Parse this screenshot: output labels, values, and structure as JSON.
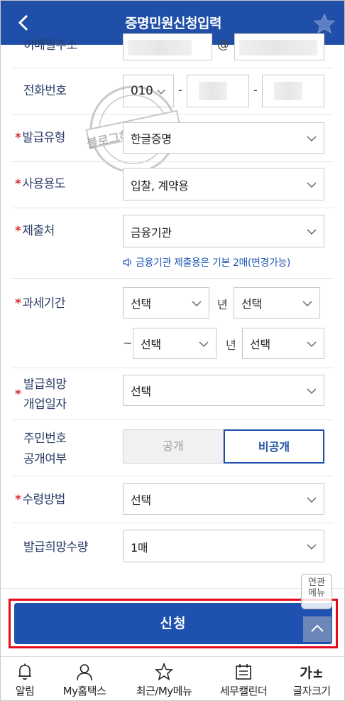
{
  "header": {
    "title": "증명민원신청입력"
  },
  "form": {
    "email": {
      "label": "이메일주소",
      "at": "@"
    },
    "phone": {
      "label": "전화번호",
      "prefix": "010",
      "dash": "-"
    },
    "issue_type": {
      "label": "발급유형",
      "value": "한글증명"
    },
    "usage": {
      "label": "사용용도",
      "value": "입찰, 계약용"
    },
    "submit_to": {
      "label": "제출처",
      "value": "금융기관",
      "notice": "금융기관 제출용은 기본 2매(변경가능)"
    },
    "tax_period": {
      "label": "과세기간",
      "start_year": "선택",
      "start_month": "선택",
      "end_year": "선택",
      "end_month": "선택",
      "year_unit": "년",
      "tilde": "~"
    },
    "open_date": {
      "label_line1": "발급희망",
      "label_line2": "개업일자",
      "value": "선택"
    },
    "rrn_disclosure": {
      "label_line1": "주민번호",
      "label_line2": "공개여부",
      "open": "공개",
      "closed": "비공개"
    },
    "receive_method": {
      "label": "수령방법",
      "value": "선택"
    },
    "quantity": {
      "label": "발급희망수량",
      "value": "1매"
    }
  },
  "required_mark": "*",
  "apply": {
    "label": "신청"
  },
  "related_menu": {
    "line1": "연관",
    "line2": "메뉴"
  },
  "watermark": {
    "text": "블로그하경닷컴"
  },
  "bottom_nav": [
    {
      "label": "알림",
      "icon": "bell-icon"
    },
    {
      "label": "My홈택스",
      "icon": "person-icon"
    },
    {
      "label": "최근/My메뉴",
      "icon": "star-icon"
    },
    {
      "label": "세무캘린더",
      "icon": "calendar-icon"
    },
    {
      "label": "글자크기",
      "icon": "font-size-icon",
      "glyph": "가±"
    }
  ],
  "colors": {
    "primary": "#1f4fa8",
    "required": "#d6262d",
    "highlight": "#e30b1c"
  }
}
